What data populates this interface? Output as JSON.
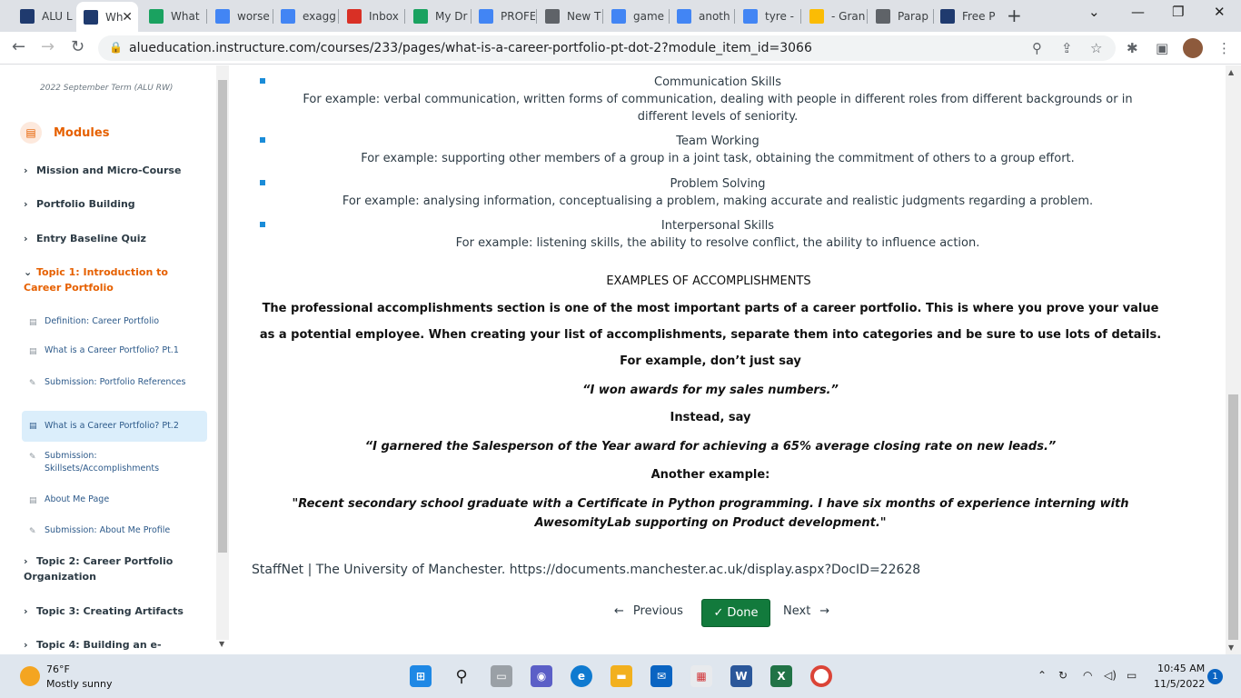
{
  "browser": {
    "tabs": [
      {
        "label": "ALU L",
        "color": "#1f3a6e"
      },
      {
        "label": "Wh",
        "color": "#1f3a6e",
        "active": true
      },
      {
        "label": "What",
        "color": "#1aa260"
      },
      {
        "label": "worse",
        "color": "#4285f4"
      },
      {
        "label": "exagg",
        "color": "#4285f4"
      },
      {
        "label": "Inbox",
        "color": "#d93025"
      },
      {
        "label": "My Dr",
        "color": "#1aa260"
      },
      {
        "label": "PROFE",
        "color": "#4285f4"
      },
      {
        "label": "New T",
        "color": "#5f6368"
      },
      {
        "label": "game",
        "color": "#4285f4"
      },
      {
        "label": "anoth",
        "color": "#4285f4"
      },
      {
        "label": "tyre -",
        "color": "#4285f4"
      },
      {
        "label": "- Gran",
        "color": "#fbbc04"
      },
      {
        "label": "Parap",
        "color": "#5f6368"
      },
      {
        "label": "Free P",
        "color": "#1f3a6e"
      }
    ],
    "new_tab": "+",
    "url": "alueducation.instructure.com/courses/233/pages/what-is-a-career-portfolio-pt-dot-2?module_item_id=3066"
  },
  "sidebar": {
    "term": "2022 September Term (ALU RW)",
    "modules_label": "Modules",
    "modules": [
      {
        "label": "Mission and Micro-Course"
      },
      {
        "label": "Portfolio Building"
      },
      {
        "label": "Entry Baseline Quiz"
      },
      {
        "label": "Topic 1: Introduction to Career Portfolio"
      },
      {
        "label": "Topic 2: Career Portfolio Organization"
      },
      {
        "label": "Topic 3: Creating Artifacts"
      },
      {
        "label": "Topic 4: Building an e-Portfolio"
      }
    ],
    "items": [
      {
        "label": "Definition: Career Portfolio"
      },
      {
        "label": "What is a Career Portfolio? Pt.1"
      },
      {
        "label": "Submission: Portfolio References"
      },
      {
        "label": "What is a Career Portfolio? Pt.2"
      },
      {
        "label": "Submission: Skillsets/Accomplishments"
      },
      {
        "label": "About Me Page"
      },
      {
        "label": "Submission: About Me Profile"
      }
    ]
  },
  "content": {
    "skills": [
      {
        "title": "Communication Skills",
        "desc": "For example: verbal communication, written forms of communication, dealing with people in different roles from different backgrounds or in different levels of seniority."
      },
      {
        "title": "Team Working",
        "desc": "For example: supporting other members of a group in a joint task, obtaining the commitment of others to a group effort."
      },
      {
        "title": "Problem Solving",
        "desc": "For example: analysing information, conceptualising a problem, making accurate and realistic judgments regarding a problem."
      },
      {
        "title": "Interpersonal Skills",
        "desc": "For example: listening skills, the ability to resolve conflict, the ability to influence action."
      }
    ],
    "examples_heading": "EXAMPLES OF ACCOMPLISHMENTS",
    "paragraph": "The professional accomplishments section is one of the most important parts of a career portfolio. This is where you prove your value as a potential employee. When creating your list of accomplishments, separate them into categories and be sure to use lots of details. For example, don’t just say",
    "quote1": "“I won awards for my sales numbers.”",
    "instead": "Instead, say",
    "quote2": "“I garnered the Salesperson of the Year award for achieving a 65% average closing rate on new leads.”",
    "another": "Another example:",
    "quote3": "\"Recent secondary school graduate with a Certificate in Python programming. I have six months of experience interning with AwesomityLab supporting on Product development.\"",
    "source": "StaffNet | The University of Manchester. https://documents.manchester.ac.uk/display.aspx?DocID=22628",
    "previous": "Previous",
    "done": "Done",
    "next": "Next"
  },
  "taskbar": {
    "temperature": "76°F",
    "weather": "Mostly sunny",
    "time": "10:45 AM",
    "date": "11/5/2022",
    "notifications": "1"
  }
}
